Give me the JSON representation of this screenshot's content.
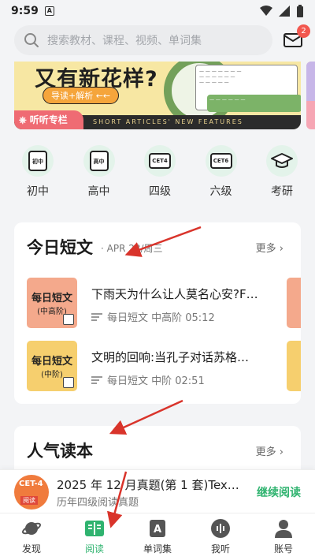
{
  "status_bar": {
    "time": "9:59",
    "notify_letter": "A"
  },
  "search": {
    "placeholder": "搜索教材、课程、视频、单词集",
    "mail_badge": "2"
  },
  "banner": {
    "headline": "又有新花样?",
    "tag": "导读+解析 ←←",
    "column_label": "听听专栏",
    "strip_text": "SHORT ARTICLES' NEW FEATURES"
  },
  "categories": [
    {
      "icon_text": "初中",
      "label": "初中"
    },
    {
      "icon_text": "高中",
      "label": "高中"
    },
    {
      "icon_text": "CET4",
      "label": "四级"
    },
    {
      "icon_text": "CET6",
      "label": "六级"
    },
    {
      "icon_text": "",
      "label": "考研"
    }
  ],
  "daily": {
    "title": "今日短文",
    "subtitle": "· APR 23/周三",
    "more": "更多 ›",
    "articles": [
      {
        "thumb_title": "每日短文",
        "thumb_level": "(中高阶)",
        "title": "下雨天为什么让人莫名心安?F…",
        "meta": "每日短文 中高阶 05:12",
        "thumb_color": "#f4a98c"
      },
      {
        "thumb_title": "每日短文",
        "thumb_level": "(中阶)",
        "title": "文明的回响:当孔子对话苏格…",
        "meta": "每日短文 中阶 02:51",
        "thumb_color": "#f6cf6e"
      }
    ]
  },
  "popular": {
    "title": "人气读本",
    "more": "更多 ›"
  },
  "now_reading": {
    "cover_label": "CET-4",
    "cover_badge": "阅读",
    "title": "2025 年 12 月真题(第 1 套)Tex…",
    "subtitle": "历年四级阅读真题",
    "continue": "继续阅读"
  },
  "tabbar": [
    {
      "label": "发现",
      "active": false
    },
    {
      "label": "阅读",
      "active": true
    },
    {
      "label": "单词集",
      "active": false
    },
    {
      "label": "我听",
      "active": false
    },
    {
      "label": "账号",
      "active": false
    }
  ],
  "colors": {
    "accent": "#2fb36f",
    "badge": "#f2574f",
    "annotation_arrow": "#d9342b"
  }
}
